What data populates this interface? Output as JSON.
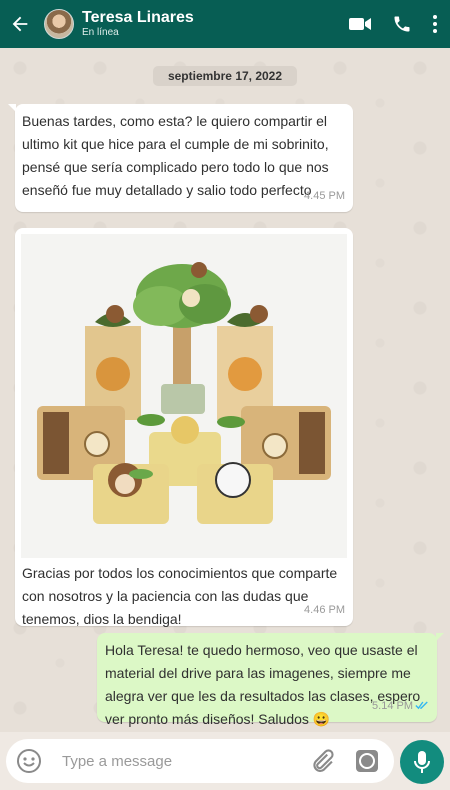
{
  "header": {
    "contact_name": "Teresa Linares",
    "status": "En línea",
    "icons": [
      "back-arrow-icon",
      "video-call-icon",
      "phone-icon",
      "more-vert-icon"
    ]
  },
  "chat": {
    "date_chip": "septiembre 17, 2022",
    "messages": [
      {
        "direction": "incoming",
        "text": "Buenas tardes, como esta? le quiero compartir el ultimo kit que hice para el cumple de mi sobrinito, pensé que sería complicado pero todo lo que nos enseñó fue muy detallado y salio todo perfecto",
        "time": "4.45 PM"
      },
      {
        "direction": "incoming",
        "has_image": true,
        "caption": "Gracias por todos los conocimientos que comparte con nosotros y la paciencia con las dudas que tenemos, dios la bendiga!",
        "time": "4.46 PM"
      },
      {
        "direction": "outgoing",
        "text": "Hola Teresa! te quedo hermoso, veo que usaste el material del drive para las imagenes, siempre me alegra ver que les da resultados las clases, espero ver pronto más diseños! Saludos 😀",
        "time": "5.14 PM",
        "status": "read"
      }
    ]
  },
  "input": {
    "placeholder": "Type a message",
    "icons": [
      "emoji-icon",
      "attach-icon",
      "camera-icon",
      "mic-icon"
    ]
  },
  "colors": {
    "header": "#075e54",
    "outgoing_bubble": "#dcf8c6",
    "mic_button": "#128c7e",
    "read_ticks": "#34b7f1"
  }
}
